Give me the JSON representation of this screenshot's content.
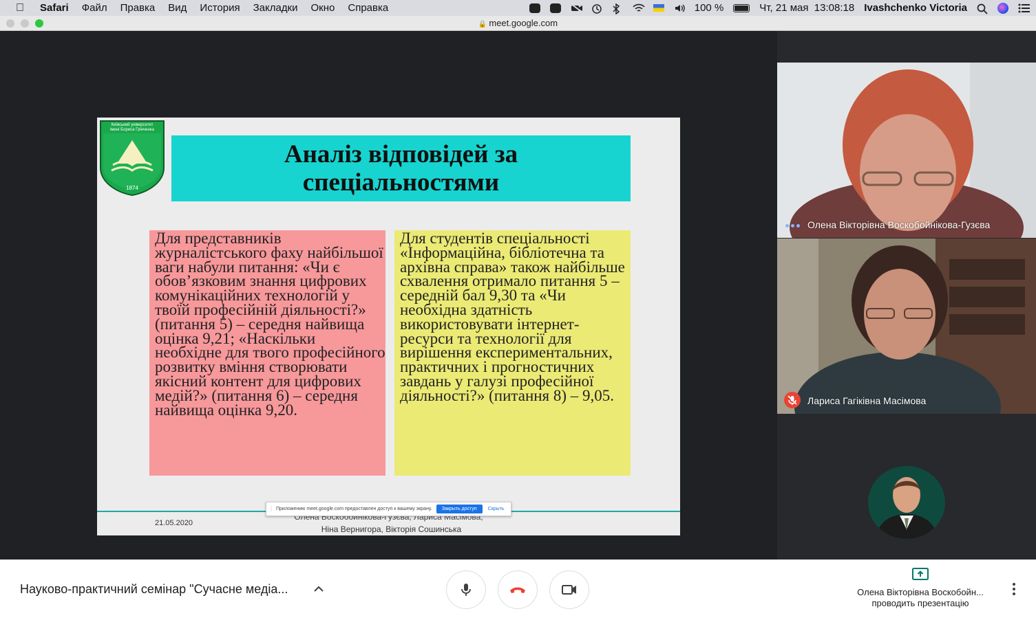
{
  "menubar": {
    "app_name": "Safari",
    "menus": [
      "Файл",
      "Правка",
      "Вид",
      "История",
      "Закладки",
      "Окно",
      "Справка"
    ],
    "battery": "100 %",
    "datetime": "Чт, 21 мая  13:08:18",
    "user": "Ivashchenko Victoria"
  },
  "browser": {
    "url": "meet.google.com"
  },
  "slide": {
    "logo_text_1": "Київський університет",
    "logo_text_2": "імені Бориса Грінченка",
    "logo_year": "1874",
    "title": "Аналіз відповідей за\nспеціальностями",
    "left_text": "Для представників журналістського фаху найбільшої ваги набули питання: «Чи є обов’язковим знання цифрових комунікаційних технологій у твоїй професійній діяльності?» (питання 5) – середня найвища оцінка 9,21; «Наскільки необхідне для твого професійного розвитку вміння створювати якісний контент для цифрових медій?» (питання 6) – середня найвища оцінка 9,20.",
    "right_text": "Для студентів спеціальності «Інформаційна, бібліотечна та архівна справа» також найбільше схвалення отримало питання 5 – середній бал 9,30 та «Чи необхідна здатність використовувати інтернет-ресурси та технології для вирішення експериментальних, практичних і прогностичних завдань у галузі професійної діяльності?» (питання 8) – 9,05.",
    "date": "21.05.2020",
    "authors_line_1": "Олена Воскобойнікова-Гузєва, Лариса Масімова,",
    "authors_line_2": "Ніна Вернигора, Вікторія Сошинська",
    "colors": {
      "title_bg": "#17d4d0",
      "left_bg": "#f7989b",
      "right_bg": "#ebea75"
    }
  },
  "share_banner": {
    "message": "Приложению meet.google.com предоставлен доступ к вашему экрану.",
    "stop_label": "Закрыть доступ",
    "hide_label": "Скрыть"
  },
  "participants": [
    {
      "name": "Олена Вікторівна Воскобойнікова-Гузєва",
      "status_icon": "speaking-dots-icon"
    },
    {
      "name": "Лариса Гагіківна Масімова",
      "status_icon": "mic-off-icon"
    }
  ],
  "bottom_bar": {
    "meeting_title": "Науково-практичний семінар \"Сучасне медіа...",
    "presenter_name": "Олена Вікторівна Воскобойн...",
    "presenter_status": "проводить презентацію",
    "colors": {
      "hangup": "#ea4335",
      "present_icon": "#00796b"
    }
  }
}
